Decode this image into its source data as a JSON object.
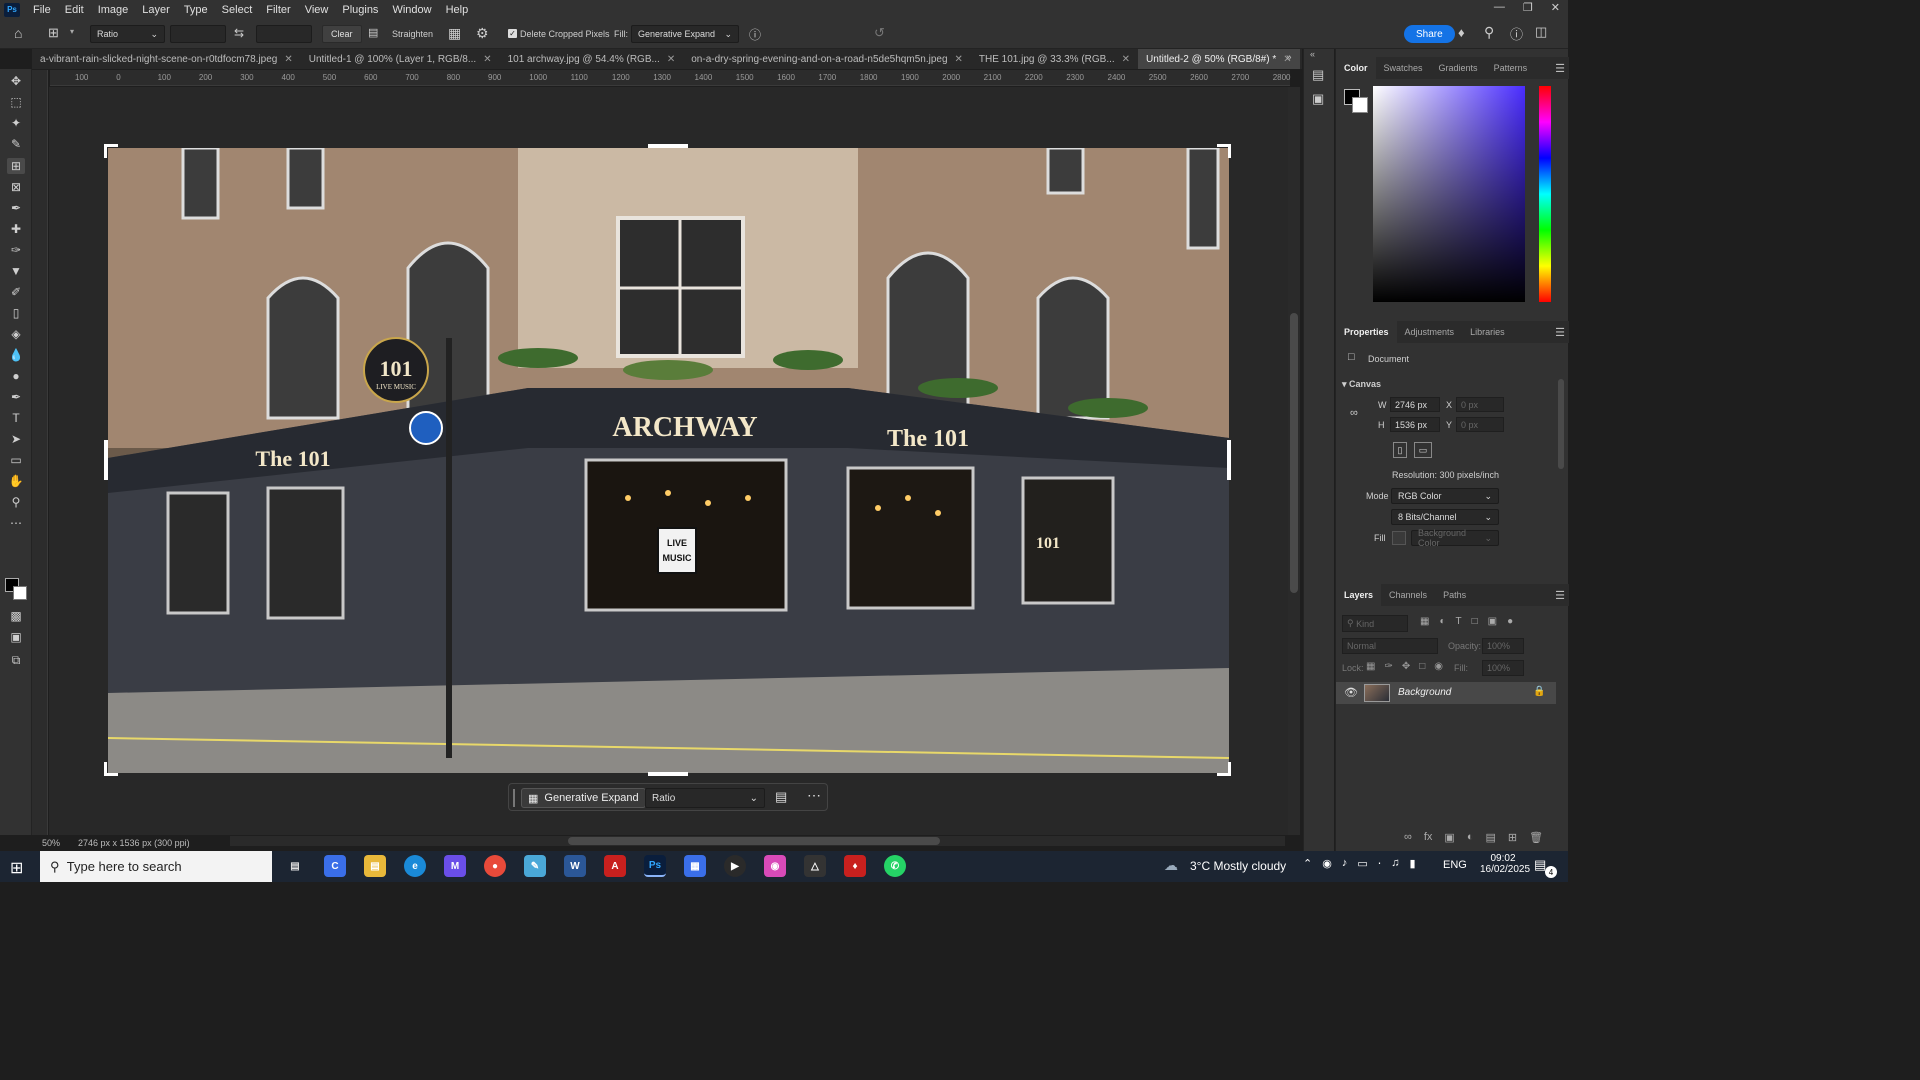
{
  "app": {
    "logo_text": "Ps"
  },
  "menu": [
    "File",
    "Edit",
    "Image",
    "Layer",
    "Type",
    "Select",
    "Filter",
    "View",
    "Plugins",
    "Window",
    "Help"
  ],
  "options_bar": {
    "ratio_label": "Ratio",
    "clear_label": "Clear",
    "straighten_label": "Straighten",
    "delete_cropped_label": "Delete Cropped Pixels",
    "delete_cropped_checked": true,
    "fill_label": "Fill:",
    "fill_value": "Generative Expand",
    "share_label": "Share"
  },
  "tabs": [
    {
      "label": "a-vibrant-rain-slicked-night-scene-on-r0tdfocm78.jpeg",
      "active": false
    },
    {
      "label": "Untitled-1 @ 100% (Layer 1, RGB/8...",
      "active": false
    },
    {
      "label": "101 archway.jpg @ 54.4% (RGB...",
      "active": false
    },
    {
      "label": "on-a-dry-spring-evening-and-on-a-road-n5de5hqm5n.jpeg",
      "active": false
    },
    {
      "label": "THE 101.jpg @ 33.3% (RGB...",
      "active": false
    },
    {
      "label": "Untitled-2 @ 50% (RGB/8#) *",
      "active": true
    }
  ],
  "ruler_ticks": [
    "100",
    "0",
    "100",
    "200",
    "300",
    "400",
    "500",
    "600",
    "700",
    "800",
    "900",
    "1000",
    "1100",
    "1200",
    "1300",
    "1400",
    "1500",
    "1600",
    "1700",
    "1800",
    "1900",
    "2000",
    "2100",
    "2200",
    "2300",
    "2400",
    "2500",
    "2600",
    "2700",
    "2800"
  ],
  "photo": {
    "sign_main": "ARCHWAY",
    "sign_left": "The 101",
    "sign_right": "The 101",
    "round_sign_number": "101",
    "round_sign_text": "LIVE MUSIC",
    "window_poster": "LIVE\nMUSIC",
    "right_window_number": "101"
  },
  "status": {
    "zoom": "50%",
    "doc_info": "2746 px x 1536 px (300 ppi)"
  },
  "context_bar": {
    "action_label": "Generative Expand",
    "ratio_label": "Ratio"
  },
  "color_panel": {
    "tabs": [
      "Color",
      "Swatches",
      "Gradients",
      "Patterns"
    ],
    "active": "Color"
  },
  "properties_panel": {
    "tabs": [
      "Properties",
      "Adjustments",
      "Libraries"
    ],
    "active": "Properties",
    "doc_label": "Document",
    "canvas_section": "Canvas",
    "w_label": "W",
    "w_value": "2746 px",
    "h_label": "H",
    "h_value": "1536 px",
    "x_label": "X",
    "x_value": "0 px",
    "y_label": "Y",
    "y_value": "0 px",
    "resolution": "Resolution: 300 pixels/inch",
    "mode_label": "Mode",
    "mode_value": "RGB Color",
    "bits_value": "8 Bits/Channel",
    "fill_label": "Fill",
    "fill_value": "Background Color"
  },
  "layers_panel": {
    "tabs": [
      "Layers",
      "Channels",
      "Paths"
    ],
    "active": "Layers",
    "kind_placeholder": "Kind",
    "blend_mode": "Normal",
    "opacity_label": "Opacity:",
    "opacity_value": "100%",
    "lock_label": "Lock:",
    "fill_label": "Fill:",
    "fill_value": "100%",
    "layer_name": "Background"
  },
  "taskbar": {
    "search_placeholder": "Type here to search",
    "weather": "3°C  Mostly cloudy",
    "language": "ENG",
    "time": "09:02",
    "date": "16/02/2025",
    "notification_count": "4"
  },
  "colors": {
    "accent": "#1473e6",
    "panel_bg": "#323232",
    "canvas_bg": "#282828"
  }
}
